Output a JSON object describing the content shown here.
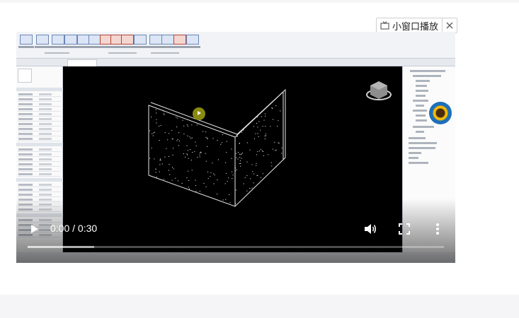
{
  "pip_button": {
    "label": "小窗口播放",
    "icon": "tv-icon",
    "close_icon": "close-icon"
  },
  "player": {
    "time_display": "0:00 / 0:30",
    "current_time": "0:00",
    "duration": "0:30",
    "buffered_fraction": 0.16,
    "played_fraction": 0.0,
    "icons": {
      "play": "play-icon",
      "volume": "volume-icon",
      "fullscreen": "fullscreen-icon",
      "more": "more-vert-icon"
    }
  },
  "colors": {
    "player_bg": "#000000",
    "wall_lines": "#ffffff",
    "cursor_halo": "#8a8a10"
  }
}
